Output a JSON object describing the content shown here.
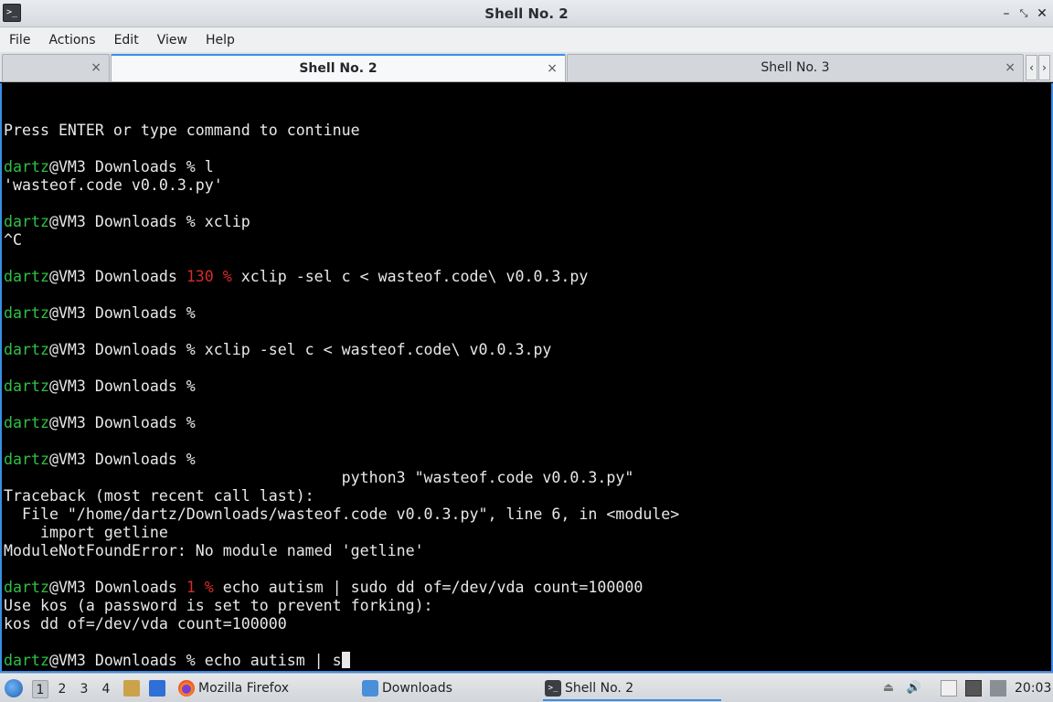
{
  "window": {
    "title": "Shell No. 2"
  },
  "menu": [
    "File",
    "Actions",
    "Edit",
    "View",
    "Help"
  ],
  "tabs": [
    {
      "label": "",
      "close": "×"
    },
    {
      "label": "Shell No. 2",
      "close": "×"
    },
    {
      "label": "Shell No. 3",
      "close": "×"
    }
  ],
  "tab_scroll": {
    "left": "‹",
    "right": "›"
  },
  "terminal": {
    "lines": [
      [
        {
          "t": "Press ENTER or type command to continue"
        }
      ],
      [],
      [
        {
          "t": "dartz",
          "c": "u"
        },
        {
          "t": "@VM3 Downloads % l"
        }
      ],
      [
        {
          "t": "'wasteof.code v0.0.3.py'"
        }
      ],
      [],
      [
        {
          "t": "dartz",
          "c": "u"
        },
        {
          "t": "@VM3 Downloads % xclip"
        }
      ],
      [
        {
          "t": "^C"
        }
      ],
      [],
      [
        {
          "t": "dartz",
          "c": "u"
        },
        {
          "t": "@VM3 Downloads "
        },
        {
          "t": "130 %",
          "c": "err"
        },
        {
          "t": " xclip -sel c < wasteof.code\\ v0.0.3.py"
        }
      ],
      [],
      [
        {
          "t": "dartz",
          "c": "u"
        },
        {
          "t": "@VM3 Downloads %"
        }
      ],
      [],
      [
        {
          "t": "dartz",
          "c": "u"
        },
        {
          "t": "@VM3 Downloads % xclip -sel c < wasteof.code\\ v0.0.3.py"
        }
      ],
      [],
      [
        {
          "t": "dartz",
          "c": "u"
        },
        {
          "t": "@VM3 Downloads %"
        }
      ],
      [],
      [
        {
          "t": "dartz",
          "c": "u"
        },
        {
          "t": "@VM3 Downloads %"
        }
      ],
      [],
      [
        {
          "t": "dartz",
          "c": "u"
        },
        {
          "t": "@VM3 Downloads %"
        }
      ],
      [
        {
          "t": "                                     python3 \"wasteof.code v0.0.3.py\""
        }
      ],
      [
        {
          "t": "Traceback (most recent call last):"
        }
      ],
      [
        {
          "t": "  File \"/home/dartz/Downloads/wasteof.code v0.0.3.py\", line 6, in <module>"
        }
      ],
      [
        {
          "t": "    import getline"
        }
      ],
      [
        {
          "t": "ModuleNotFoundError: No module named 'getline'"
        }
      ],
      [],
      [
        {
          "t": "dartz",
          "c": "u"
        },
        {
          "t": "@VM3 Downloads "
        },
        {
          "t": "1 %",
          "c": "err"
        },
        {
          "t": " echo autism | sudo dd of=/dev/vda count=100000"
        }
      ],
      [
        {
          "t": "Use kos (a password is set to prevent forking):"
        }
      ],
      [
        {
          "t": "kos dd of=/dev/vda count=100000"
        }
      ],
      [],
      [
        {
          "t": "dartz",
          "c": "u"
        },
        {
          "t": "@VM3 Downloads % echo autism | s"
        },
        {
          "cursor": true
        }
      ]
    ]
  },
  "taskbar": {
    "desktops": [
      "1",
      "2",
      "3",
      "4"
    ],
    "tasks": [
      "Mozilla Firefox",
      "Downloads",
      "Shell No. 2"
    ],
    "clock": "20:03"
  },
  "colors": {
    "user": "#2fbf45",
    "error_status": "#d62b2b",
    "accent": "#3a8ee6"
  }
}
